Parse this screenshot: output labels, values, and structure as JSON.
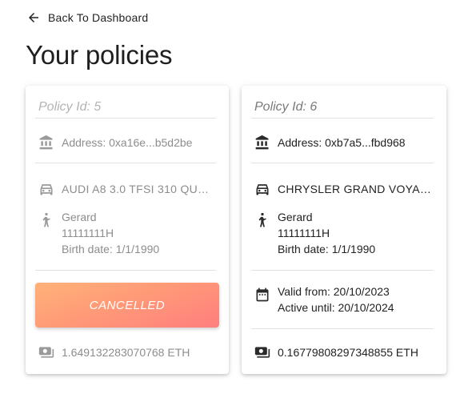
{
  "nav": {
    "back_label": "Back To Dashboard"
  },
  "page": {
    "title": "Your policies"
  },
  "policies": [
    {
      "id_label": "Policy Id: 5",
      "address": "Address: 0xa16e...b5d2be",
      "car": "AUDI A8 3.0 TFSI 310 QUA...",
      "holder": {
        "name": "Gerard",
        "license": "11111111H",
        "birth": "Birth date: 1/1/1990"
      },
      "status_button": "CANCELLED",
      "amount": "1.649132283070768 ETH"
    },
    {
      "id_label": "Policy Id: 6",
      "address": "Address: 0xb7a5...fbd968",
      "car": "CHRYSLER GRAND VOYAG...",
      "holder": {
        "name": "Gerard",
        "license": "11111111H",
        "birth": "Birth date: 1/1/1990"
      },
      "valid_from": "Valid from: 20/10/2023",
      "active_until": "Active until: 20/10/2024",
      "amount": "0.16779808297348855 ETH"
    }
  ],
  "colors": {
    "cancel_gradient_start": "#ffb279",
    "cancel_gradient_end": "#ff7e7e",
    "muted_text": "#8d8d8d"
  },
  "icons": [
    "arrow-left-icon",
    "bank-icon",
    "car-icon",
    "person-icon",
    "calendar-icon",
    "cash-icon"
  ]
}
